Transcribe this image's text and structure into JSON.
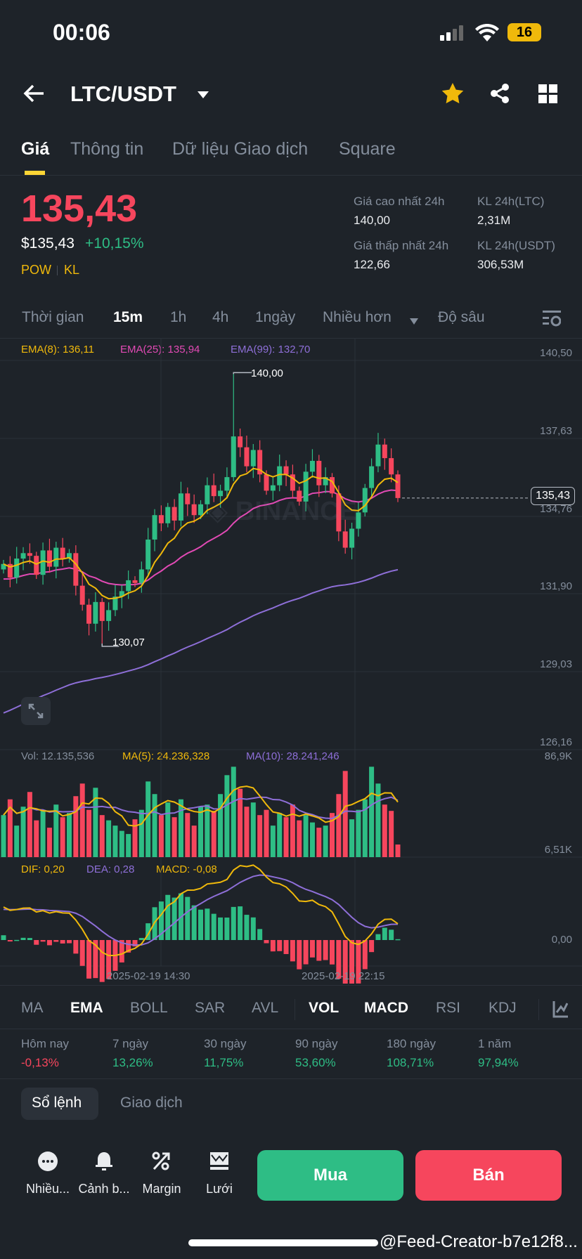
{
  "status": {
    "time": "00:06",
    "battery": "16"
  },
  "header": {
    "pair": "LTC/USDT"
  },
  "tabs": [
    "Giá",
    "Thông tin",
    "Dữ liệu Giao dịch",
    "Square"
  ],
  "price": {
    "last": "135,43",
    "usd": "$135,43",
    "change": "+10,15%",
    "tag1": "POW",
    "tag2": "KL"
  },
  "stats": {
    "high_label": "Giá cao nhất 24h",
    "high": "140,00",
    "low_label": "Giá thấp nhất 24h",
    "low": "122,66",
    "vol_ltc_label": "KL 24h(LTC)",
    "vol_ltc": "2,31M",
    "vol_usdt_label": "KL 24h(USDT)",
    "vol_usdt": "306,53M"
  },
  "intervals": [
    "Thời gian",
    "15m",
    "1h",
    "4h",
    "1ngày",
    "Nhiều hơn",
    "Độ sâu"
  ],
  "legend": {
    "ema8": "EMA(8): 136,11",
    "ema25": "EMA(25): 135,94",
    "ema99": "EMA(99): 132,70",
    "vol": "Vol: 12.135,536",
    "ma5": "MA(5): 24.236,328",
    "ma10": "MA(10): 28.241,246",
    "dif": "DIF: 0,20",
    "dea": "DEA: 0,28",
    "macd": "MACD: -0,08"
  },
  "chart_data": {
    "type": "candlestick",
    "price_axis": [
      "140,50",
      "137,63",
      "134,76",
      "131,90",
      "129,03",
      "126,16"
    ],
    "ylim": [
      126.16,
      140.5
    ],
    "last_price_label": "135,43",
    "max_label": "140,00",
    "min_label": "130,07",
    "max": {
      "index": 35,
      "value": 140.0
    },
    "min": {
      "index": 15,
      "value": 130.07
    },
    "first_open": 132.8,
    "closes": [
      133.0,
      132.5,
      133.2,
      133.4,
      133.3,
      132.6,
      133.5,
      132.9,
      133.6,
      133.2,
      133.4,
      132.2,
      131.5,
      130.8,
      131.6,
      130.9,
      131.3,
      131.8,
      132.0,
      132.4,
      132.3,
      132.8,
      133.9,
      134.8,
      134.5,
      135.1,
      134.6,
      135.6,
      135.2,
      134.8,
      135.2,
      135.9,
      135.5,
      135.7,
      136.2,
      137.7,
      137.3,
      136.6,
      137.2,
      136.3,
      135.7,
      135.9,
      136.6,
      136.3,
      135.7,
      135.3,
      136.4,
      136.8,
      135.9,
      136.2,
      135.6,
      134.2,
      133.6,
      134.3,
      134.9,
      135.8,
      136.6,
      137.4,
      136.9,
      136.3,
      135.43
    ],
    "ema_seeds": {
      "ema99": 127.4
    },
    "volume_axis": [
      "86,9K",
      "6,51K"
    ],
    "volume_k": [
      40,
      55,
      30,
      48,
      62,
      35,
      45,
      28,
      50,
      38,
      42,
      58,
      70,
      45,
      66,
      40,
      35,
      30,
      25,
      22,
      36,
      45,
      72,
      60,
      40,
      52,
      38,
      55,
      42,
      30,
      48,
      50,
      44,
      60,
      78,
      86,
      65,
      48,
      52,
      40,
      45,
      30,
      42,
      38,
      50,
      35,
      40,
      33,
      28,
      30,
      42,
      60,
      82,
      36,
      45,
      55,
      86,
      70,
      50,
      44,
      12
    ],
    "macd_axis": "0,00",
    "dates": [
      "2025-02-19 14:30",
      "2025-02-19 22:15"
    ]
  },
  "indicators": [
    "MA",
    "EMA",
    "BOLL",
    "SAR",
    "AVL",
    "VOL",
    "MACD",
    "RSI",
    "KDJ"
  ],
  "performance": [
    {
      "label": "Hôm nay",
      "value": "-0,13%"
    },
    {
      "label": "7 ngày",
      "value": "13,26%"
    },
    {
      "label": "30 ngày",
      "value": "11,75%"
    },
    {
      "label": "90 ngày",
      "value": "53,60%"
    },
    {
      "label": "180 ngày",
      "value": "108,71%"
    },
    {
      "label": "1 năm",
      "value": "97,94%"
    }
  ],
  "book_tabs": [
    "Sổ lệnh",
    "Giao dịch"
  ],
  "actions": [
    "Nhiều...",
    "Cảnh b...",
    "Margin",
    "Lưới"
  ],
  "buy": "Mua",
  "sell": "Bán",
  "watermark": "@Feed-Creator-b7e12f8...",
  "colors": {
    "up": "#2ebd85",
    "down": "#f6465d",
    "accent": "#fcd535",
    "ema8": "#f0b90b",
    "ema25": "#e24ab5",
    "ema99": "#8e6fd8"
  }
}
